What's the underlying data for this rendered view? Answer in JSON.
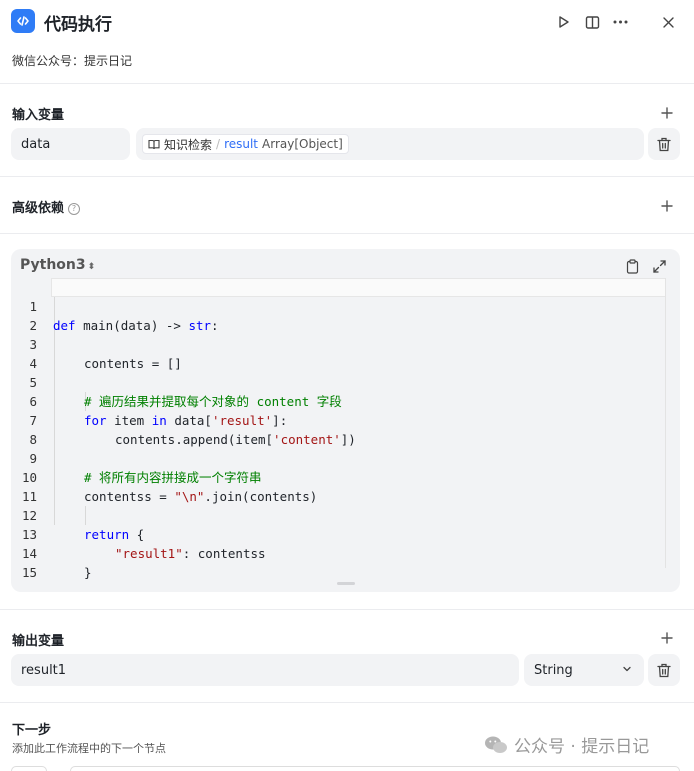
{
  "header": {
    "title": "代码执行",
    "icon": "code-icon",
    "actions": [
      "run-icon",
      "split-view-icon",
      "more-icon",
      "close-icon"
    ]
  },
  "description": "微信公众号：提示日记",
  "input_section": {
    "title": "输入变量",
    "variable": {
      "name": "data",
      "ref_source": "知识检索",
      "ref_separator": "/",
      "ref_var": "result",
      "ref_type": "Array[Object]"
    }
  },
  "advanced_section": {
    "title": "高级依赖",
    "help": "?"
  },
  "editor": {
    "language": "Python3",
    "lines": [
      {
        "n": "1"
      },
      {
        "n": "2"
      },
      {
        "n": "3"
      },
      {
        "n": "4"
      },
      {
        "n": "5"
      },
      {
        "n": "6"
      },
      {
        "n": "7"
      },
      {
        "n": "8"
      },
      {
        "n": "9"
      },
      {
        "n": "10"
      },
      {
        "n": "11"
      },
      {
        "n": "12"
      },
      {
        "n": "13"
      },
      {
        "n": "14"
      },
      {
        "n": "15"
      }
    ],
    "code": {
      "l1_def": "def",
      "l1_rest": " main(data) -> ",
      "l1_str": "str",
      "l1_colon": ":",
      "l3": "contents = []",
      "l5": "# 遍历结果并提取每个对象的 content 字段",
      "l6_for": "for",
      "l6_mid": " item ",
      "l6_in": "in",
      "l6_rest1": " data[",
      "l6_str": "'result'",
      "l6_rest2": "]:",
      "l7_a": "contents.append(item[",
      "l7_str": "'content'",
      "l7_b": "])",
      "l9": "# 将所有内容拼接成一个字符串",
      "l10_a": "contentss = ",
      "l10_str": "\"\\n\"",
      "l10_b": ".join(contents)",
      "l12_ret": "return",
      "l12_rest": " {",
      "l13_str": "\"result1\"",
      "l13_rest": ": contentss",
      "l14": "}"
    }
  },
  "output_section": {
    "title": "输出变量",
    "variable": {
      "name": "result1",
      "type": "String"
    }
  },
  "next_section": {
    "title": "下一步",
    "subtitle": "添加此工作流程中的下一个节点"
  },
  "watermark": {
    "text": "公众号 · 提示日记"
  },
  "colors": {
    "accent": "#2f7cf6",
    "keyword": "#0000ff",
    "string": "#a31515",
    "comment": "#008000"
  }
}
